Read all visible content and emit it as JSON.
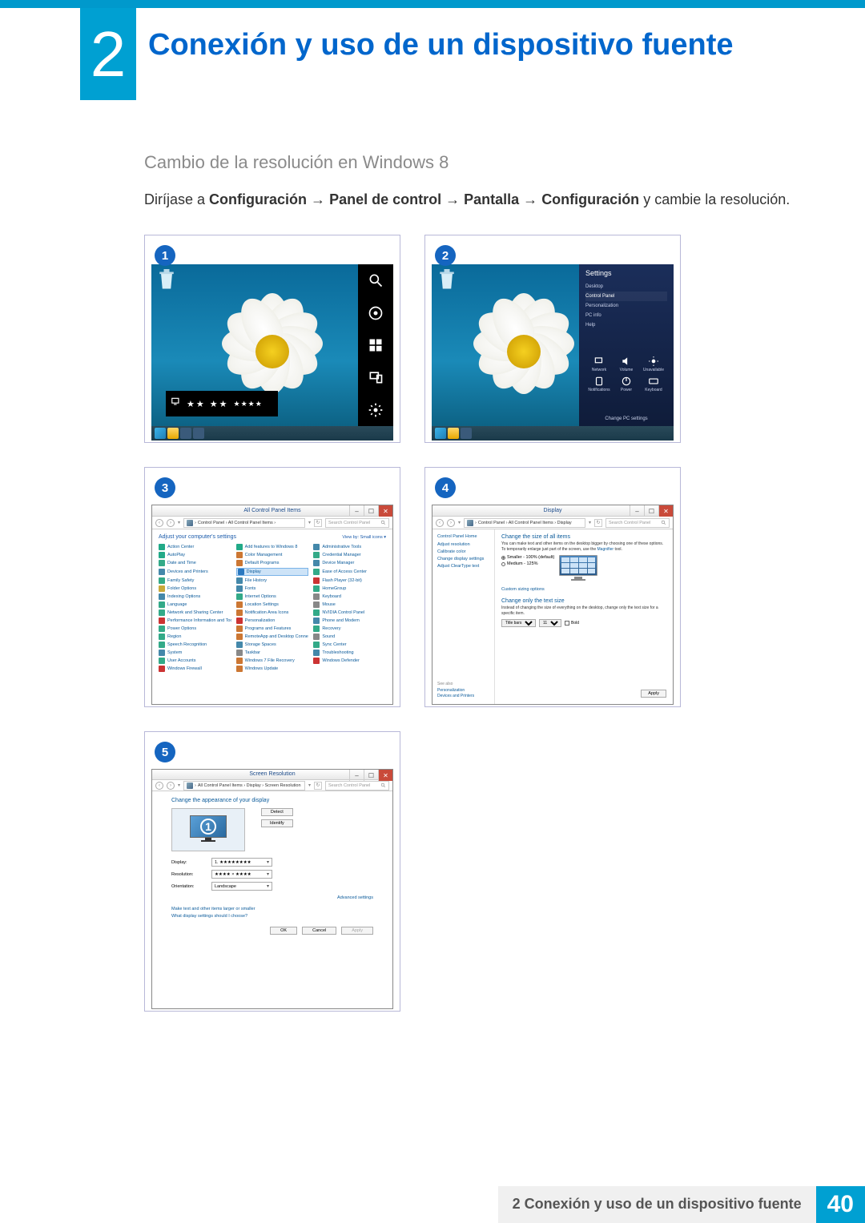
{
  "chapter": {
    "number": "2",
    "title": "Conexión y uso de un dispositivo fuente"
  },
  "section": {
    "heading": "Cambio de la resolución en Windows 8"
  },
  "instruction": {
    "prefix": "Diríjase a ",
    "path": [
      "Configuración",
      "Panel de control",
      "Pantalla",
      "Configuración"
    ],
    "suffix": " y cambie la resolución."
  },
  "steps": {
    "s1": "1",
    "s2": "2",
    "s3": "3",
    "s4": "4",
    "s5": "5"
  },
  "fig1": {
    "charms": {
      "search": "Search",
      "share": "Share",
      "start": "Start",
      "devices": "Devices",
      "settings": "Settings"
    },
    "clock": {
      "time": "★★  ★★",
      "date": "★★★★"
    }
  },
  "fig2": {
    "pane_title": "Settings",
    "items": [
      "Desktop",
      "Control Panel",
      "Personalization",
      "PC info",
      "Help"
    ],
    "icons": [
      {
        "label": "Network"
      },
      {
        "label": "Volume"
      },
      {
        "label": "Unavailable"
      },
      {
        "label": "Notifications"
      },
      {
        "label": "Power"
      },
      {
        "label": "Keyboard"
      }
    ],
    "bottom": "Change PC settings"
  },
  "fig3": {
    "title": "All Control Panel Items",
    "breadcrumb": "Control Panel  ›  All Control Panel Items  ›",
    "search_ph": "Search Control Panel",
    "heading": "Adjust your computer's settings",
    "viewby": "View by:   Small icons ▾",
    "items": [
      {
        "t": "Action Center",
        "c": "#2a8"
      },
      {
        "t": "Add features to Windows 8",
        "c": "#2a8"
      },
      {
        "t": "Administrative Tools",
        "c": "#48a"
      },
      {
        "t": "AutoPlay",
        "c": "#2a8"
      },
      {
        "t": "Color Management",
        "c": "#c73"
      },
      {
        "t": "Credential Manager",
        "c": "#3a8"
      },
      {
        "t": "Date and Time",
        "c": "#3a8"
      },
      {
        "t": "Default Programs",
        "c": "#c73"
      },
      {
        "t": "Device Manager",
        "c": "#48a"
      },
      {
        "t": "Devices and Printers",
        "c": "#48a"
      },
      {
        "t": "Display",
        "c": "#2a78c0",
        "hl": true
      },
      {
        "t": "Ease of Access Center",
        "c": "#3a8"
      },
      {
        "t": "Family Safety",
        "c": "#3a8"
      },
      {
        "t": "File History",
        "c": "#48a"
      },
      {
        "t": "Flash Player (32-bit)",
        "c": "#c33"
      },
      {
        "t": "Folder Options",
        "c": "#c9a93a"
      },
      {
        "t": "Fonts",
        "c": "#48a"
      },
      {
        "t": "HomeGroup",
        "c": "#3a8"
      },
      {
        "t": "Indexing Options",
        "c": "#48a"
      },
      {
        "t": "Internet Options",
        "c": "#3a8"
      },
      {
        "t": "Keyboard",
        "c": "#888"
      },
      {
        "t": "Language",
        "c": "#3a8"
      },
      {
        "t": "Location Settings",
        "c": "#c73"
      },
      {
        "t": "Mouse",
        "c": "#888"
      },
      {
        "t": "Network and Sharing Center",
        "c": "#3a8"
      },
      {
        "t": "Notification Area Icons",
        "c": "#c73"
      },
      {
        "t": "NVIDIA Control Panel",
        "c": "#3a8"
      },
      {
        "t": "Performance Information and Tools",
        "c": "#c33"
      },
      {
        "t": "Personalization",
        "c": "#c33"
      },
      {
        "t": "Phone and Modem",
        "c": "#48a"
      },
      {
        "t": "Power Options",
        "c": "#3a8"
      },
      {
        "t": "Programs and Features",
        "c": "#c73"
      },
      {
        "t": "Recovery",
        "c": "#3a8"
      },
      {
        "t": "Region",
        "c": "#3a8"
      },
      {
        "t": "RemoteApp and Desktop Connections",
        "c": "#c73"
      },
      {
        "t": "Sound",
        "c": "#888"
      },
      {
        "t": "Speech Recognition",
        "c": "#3a8"
      },
      {
        "t": "Storage Spaces",
        "c": "#48a"
      },
      {
        "t": "Sync Center",
        "c": "#3a8"
      },
      {
        "t": "System",
        "c": "#48a"
      },
      {
        "t": "Taskbar",
        "c": "#888"
      },
      {
        "t": "Troubleshooting",
        "c": "#48a"
      },
      {
        "t": "User Accounts",
        "c": "#3a8"
      },
      {
        "t": "Windows 7 File Recovery",
        "c": "#c73"
      },
      {
        "t": "Windows Defender",
        "c": "#c33"
      },
      {
        "t": "Windows Firewall",
        "c": "#c33"
      },
      {
        "t": "Windows Update",
        "c": "#c73"
      }
    ]
  },
  "fig4": {
    "title": "Display",
    "breadcrumb": "Control Panel  ›  All Control Panel Items  ›  Display",
    "search_ph": "Search Control Panel",
    "side": {
      "head": "Control Panel Home",
      "links": [
        "Adjust resolution",
        "Calibrate color",
        "Change display settings",
        "Adjust ClearType text"
      ],
      "seealso_lbl": "See also",
      "seealso": [
        "Personalization",
        "Devices and Printers"
      ]
    },
    "main": {
      "h1": "Change the size of all items",
      "p1a": "You can make text and other items on the desktop bigger by choosing one of these options. To temporarily enlarge just part of the screen, use the ",
      "p1link": "Magnifier",
      "p1b": " tool.",
      "opt1": "Smaller - 100% (default)",
      "opt2": "Medium - 125%",
      "custom": "Custom sizing options",
      "h2": "Change only the text size",
      "p2": "Instead of changing the size of everything on the desktop, change only the text size for a specific item.",
      "sel_label": "Title bars",
      "sel_size": "11",
      "chk": "Bold",
      "apply": "Apply"
    }
  },
  "fig5": {
    "title": "Screen Resolution",
    "breadcrumb": "All Control Panel Items  ›  Display  ›  Screen Resolution",
    "search_ph": "Search Control Panel",
    "h1": "Change the appearance of your display",
    "monitor_id": "1",
    "btn_detect": "Detect",
    "btn_identify": "Identify",
    "fields": {
      "display_lbl": "Display:",
      "display_val": "1. ★★★★★★★★",
      "resolution_lbl": "Resolution:",
      "resolution_val": "★★★★ × ★★★★",
      "orientation_lbl": "Orientation:",
      "orientation_val": "Landscape"
    },
    "adv": "Advanced settings",
    "link1": "Make text and other items larger or smaller",
    "link2": "What display settings should I choose?",
    "ok": "OK",
    "cancel": "Cancel",
    "apply": "Apply"
  },
  "footer": {
    "text": "2 Conexión y uso de un dispositivo fuente",
    "page": "40"
  }
}
